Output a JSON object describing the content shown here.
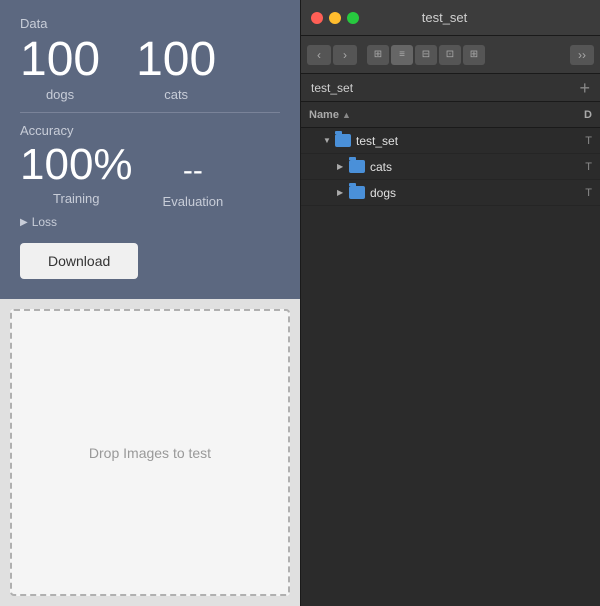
{
  "left": {
    "stats_label": "Data",
    "dogs_count": "100",
    "dogs_label": "dogs",
    "cats_count": "100",
    "cats_label": "cats",
    "accuracy_label": "Accuracy",
    "training_value": "100%",
    "training_label": "Training",
    "eval_value": "--",
    "eval_label": "Evaluation",
    "loss_label": "Loss",
    "download_btn": "Download",
    "drop_text": "Drop Images to test"
  },
  "finder": {
    "title": "test_set",
    "path": "test_set",
    "col_name": "Name",
    "col_date": "D",
    "root_folder": "test_set",
    "cats_folder": "cats",
    "dogs_folder": "dogs",
    "icons": {
      "back": "‹",
      "forward": "›",
      "view_icon": "⊞",
      "add": "+"
    }
  }
}
